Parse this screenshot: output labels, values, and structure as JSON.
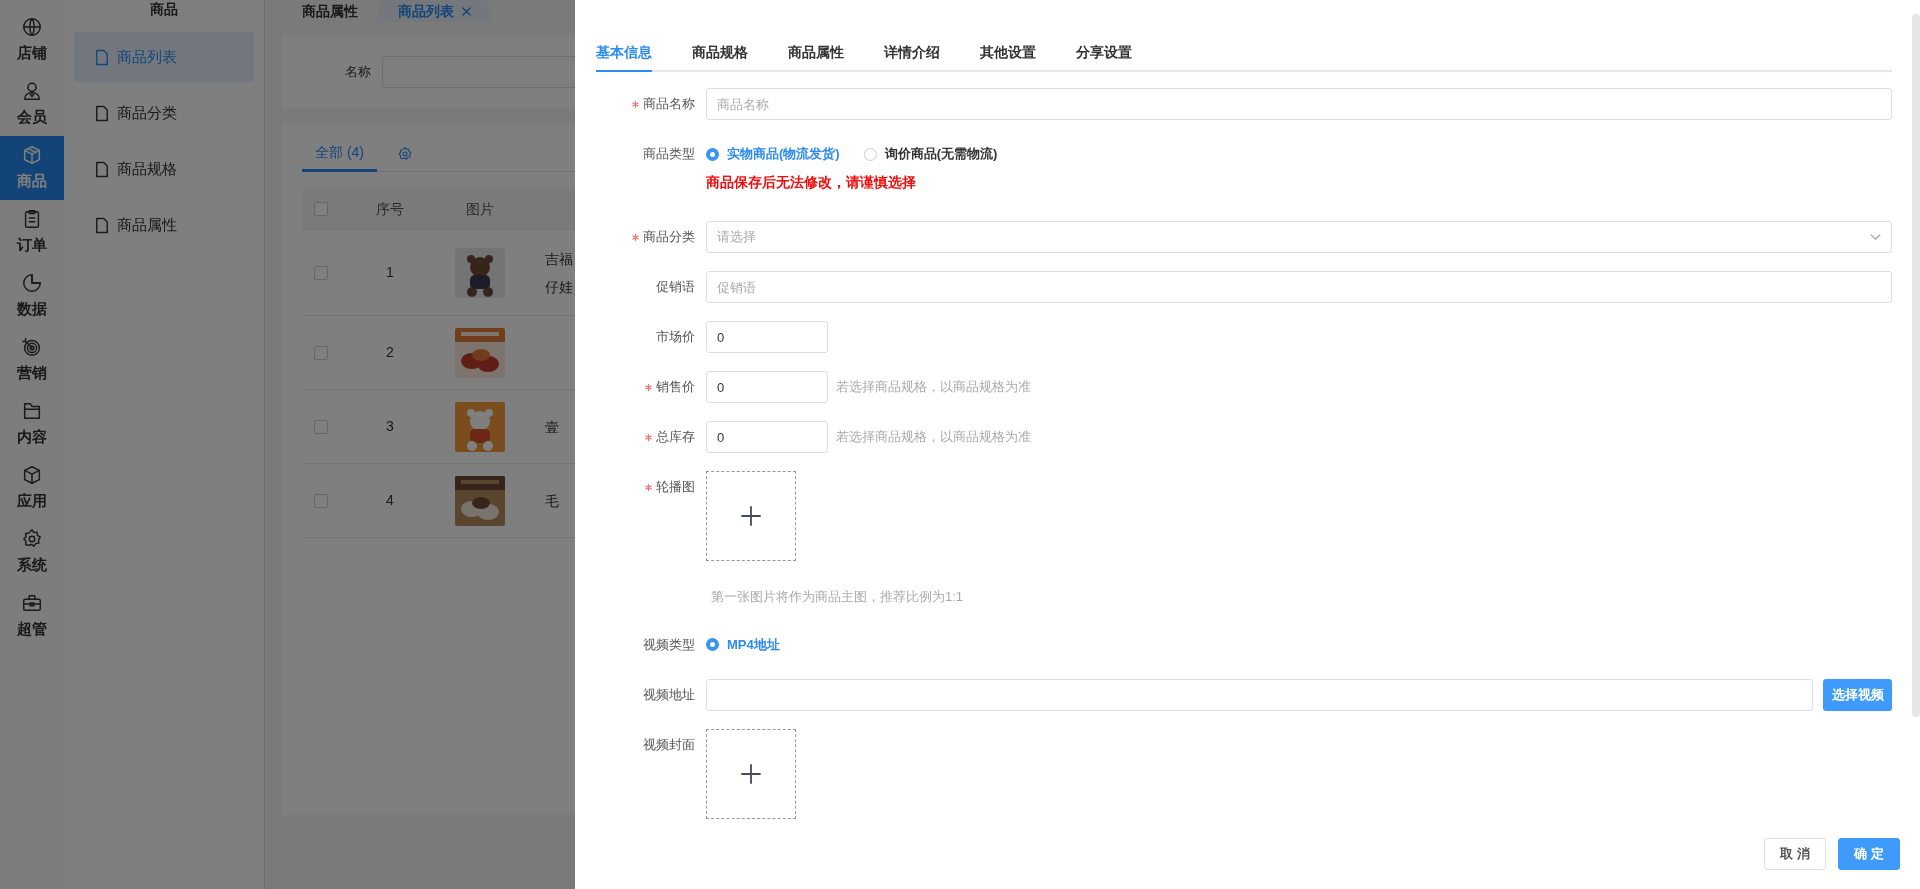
{
  "sidebar": {
    "items": [
      {
        "label": "店铺",
        "selected": false
      },
      {
        "label": "会员",
        "selected": false
      },
      {
        "label": "商品",
        "selected": true
      },
      {
        "label": "订单",
        "selected": false
      },
      {
        "label": "数据",
        "selected": false
      },
      {
        "label": "营销",
        "selected": false
      },
      {
        "label": "内容",
        "selected": false
      },
      {
        "label": "应用",
        "selected": false
      },
      {
        "label": "系统",
        "selected": false
      },
      {
        "label": "超管",
        "selected": false
      }
    ]
  },
  "submenu": {
    "title": "商品",
    "items": [
      {
        "label": "商品列表",
        "selected": true
      },
      {
        "label": "商品分类",
        "selected": false
      },
      {
        "label": "商品规格",
        "selected": false
      },
      {
        "label": "商品属性",
        "selected": false
      }
    ]
  },
  "page_tabs": [
    {
      "label": "商品属性",
      "selected": false,
      "closable": false
    },
    {
      "label": "商品列表",
      "selected": true,
      "closable": true
    }
  ],
  "search": {
    "label": "名称"
  },
  "list_tabs": [
    {
      "label": "全部 (4)",
      "selected": true
    }
  ],
  "table": {
    "columns": [
      "序号",
      "图片"
    ],
    "header_checked": false,
    "rows": [
      {
        "index": "1",
        "checked": false,
        "name": [
          "吉福",
          "仔娃"
        ]
      },
      {
        "index": "2",
        "checked": false,
        "name": []
      },
      {
        "index": "3",
        "checked": false,
        "name": [
          "壹"
        ]
      },
      {
        "index": "4",
        "checked": false,
        "name": [
          "毛"
        ]
      }
    ]
  },
  "drawer": {
    "tabs": [
      {
        "label": "基本信息",
        "selected": true
      },
      {
        "label": "商品规格",
        "selected": false
      },
      {
        "label": "商品属性",
        "selected": false
      },
      {
        "label": "详情介绍",
        "selected": false
      },
      {
        "label": "其他设置",
        "selected": false
      },
      {
        "label": "分享设置",
        "selected": false
      }
    ],
    "fields": [
      {
        "kind": "text",
        "label": "商品名称",
        "required": true,
        "placeholder": "商品名称"
      },
      {
        "kind": "radio",
        "label": "商品类型",
        "required": false,
        "options": [
          {
            "label": "实物商品(物流发货)",
            "selected": true
          },
          {
            "label": "询价商品(无需物流)",
            "selected": false
          }
        ],
        "warning": "商品保存后无法修改，请谨慎选择"
      },
      {
        "kind": "select",
        "label": "商品分类",
        "required": true,
        "placeholder": "请选择"
      },
      {
        "kind": "text",
        "label": "促销语",
        "required": false,
        "placeholder": "促销语"
      },
      {
        "kind": "number",
        "label": "市场价",
        "required": false,
        "value": "0"
      },
      {
        "kind": "number",
        "label": "销售价",
        "required": true,
        "value": "0",
        "hint": "若选择商品规格，以商品规格为准"
      },
      {
        "kind": "number",
        "label": "总库存",
        "required": true,
        "value": "0",
        "hint": "若选择商品规格，以商品规格为准"
      },
      {
        "kind": "upload",
        "label": "轮播图",
        "required": true,
        "tip": "第一张图片将作为商品主图，推荐比例为1:1"
      },
      {
        "kind": "radio",
        "label": "视频类型",
        "required": false,
        "options": [
          {
            "label": "MP4地址",
            "selected": true
          }
        ]
      },
      {
        "kind": "input_button",
        "label": "视频地址",
        "required": false,
        "button": "选择视频"
      },
      {
        "kind": "upload",
        "label": "视频封面",
        "required": false
      }
    ],
    "footer": {
      "cancel": "取 消",
      "confirm": "确 定"
    }
  }
}
